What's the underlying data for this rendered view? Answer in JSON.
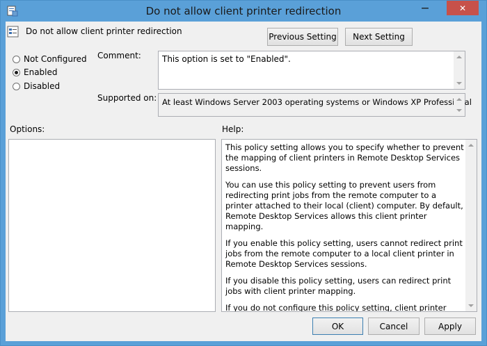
{
  "window": {
    "title": "Do not allow client printer redirection",
    "minimize_glyph": "—",
    "close_glyph": "✕"
  },
  "header": {
    "setting_name": "Do not allow client printer redirection",
    "previous_setting_label": "Previous Setting",
    "next_setting_label": "Next Setting"
  },
  "state": {
    "options": [
      {
        "label": "Not Configured",
        "selected": false
      },
      {
        "label": "Enabled",
        "selected": true
      },
      {
        "label": "Disabled",
        "selected": false
      }
    ]
  },
  "comment": {
    "label": "Comment:",
    "value": "This option is set to \"Enabled\"."
  },
  "supported": {
    "label": "Supported on:",
    "value": "At least Windows Server 2003 operating systems or Windows XP Professional"
  },
  "options_panel": {
    "label": "Options:"
  },
  "help_panel": {
    "label": "Help:",
    "paragraphs": [
      "This policy setting allows you to specify whether to prevent the mapping of client printers in Remote Desktop Services sessions.",
      "You can use this policy setting to prevent users from redirecting print jobs from the remote computer to a printer attached to their local (client) computer. By default, Remote Desktop Services allows this client printer mapping.",
      "If you enable this policy setting, users cannot redirect print jobs from the remote computer to a local client printer in Remote Desktop Services sessions.",
      "If you disable this policy setting, users can redirect print jobs with client printer mapping.",
      "If you do not configure this policy setting, client printer mapping is not specified at the Group Policy level."
    ]
  },
  "footer": {
    "ok_label": "OK",
    "cancel_label": "Cancel",
    "apply_label": "Apply"
  }
}
